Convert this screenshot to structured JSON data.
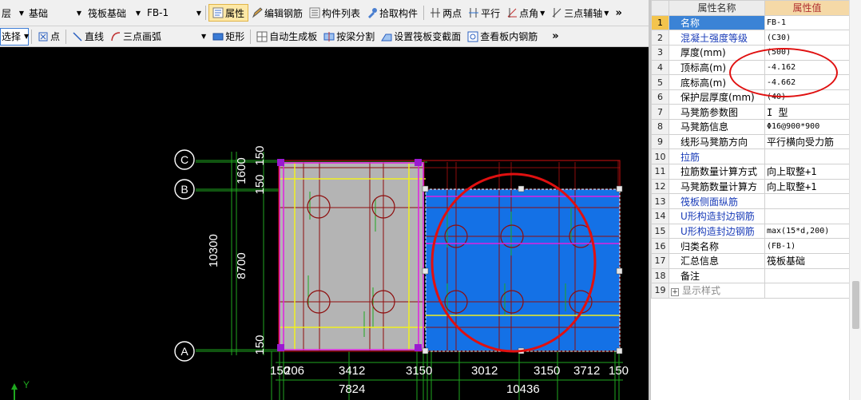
{
  "toolbar1": {
    "floor_combo": "层",
    "category_combo": "基础",
    "type_combo": "筏板基础",
    "element_combo": "FB-1",
    "properties_label": "属性",
    "edit_rebar_label": "编辑钢筋",
    "component_list_label": "构件列表",
    "pick_component_label": "拾取构件",
    "two_points_label": "两点",
    "parallel_label": "平行",
    "point_angle_label": "点角",
    "three_point_aux_label": "三点辅轴",
    "more_label": "»"
  },
  "toolbar2": {
    "select_label": "选择",
    "point_label": "点",
    "line_label": "直线",
    "arc3_label": "三点画弧",
    "rect_label": "矩形",
    "auto_gen_label": "自动生成板",
    "split_by_beam_label": "按梁分割",
    "set_slope_label": "设置筏板变截面",
    "view_rebar_label": "查看板内钢筋",
    "more_label": "»"
  },
  "drawing": {
    "axis_labels": [
      "C",
      "B",
      "A"
    ],
    "left_dims": [
      "150",
      "1600",
      "150",
      "8700",
      "150"
    ],
    "total_height_dim": "10300",
    "bottom_dims_row1": [
      "150",
      "206",
      "3412",
      "3150",
      "3012",
      "3150",
      "3712",
      "150"
    ],
    "bottom_dims_row2": [
      "7824",
      "10436"
    ],
    "ucs_label": "Y"
  },
  "properties": {
    "header_name": "属性名称",
    "header_value": "属性值",
    "rows": [
      {
        "no": "1",
        "name": "名称",
        "value": "FB-1",
        "blue": false
      },
      {
        "no": "2",
        "name": "混凝土强度等级",
        "value": "(C30)",
        "blue": true
      },
      {
        "no": "3",
        "name": "厚度(mm)",
        "value": "(500)",
        "blue": false
      },
      {
        "no": "4",
        "name": "顶标高(m)",
        "value": "-4.162",
        "blue": false
      },
      {
        "no": "5",
        "name": "底标高(m)",
        "value": "-4.662",
        "blue": false
      },
      {
        "no": "6",
        "name": "保护层厚度(mm)",
        "value": "(40)",
        "blue": false
      },
      {
        "no": "7",
        "name": "马凳筋参数图",
        "value": "I 型",
        "blue": false
      },
      {
        "no": "8",
        "name": "马凳筋信息",
        "value": "Φ16@900*900",
        "blue": false
      },
      {
        "no": "9",
        "name": "线形马凳筋方向",
        "value": "平行横向受力筋",
        "blue": false
      },
      {
        "no": "10",
        "name": "拉筋",
        "value": "",
        "blue": true
      },
      {
        "no": "11",
        "name": "拉筋数量计算方式",
        "value": "向上取整+1",
        "blue": false
      },
      {
        "no": "12",
        "name": "马凳筋数量计算方",
        "value": "向上取整+1",
        "blue": false
      },
      {
        "no": "13",
        "name": "筏板侧面纵筋",
        "value": "",
        "blue": true
      },
      {
        "no": "14",
        "name": "U形构造封边钢筋",
        "value": "",
        "blue": true
      },
      {
        "no": "15",
        "name": "U形构造封边钢筋",
        "value": "max(15*d,200)",
        "blue": true
      },
      {
        "no": "16",
        "name": "归类名称",
        "value": "(FB-1)",
        "blue": false
      },
      {
        "no": "17",
        "name": "汇总信息",
        "value": "筏板基础",
        "blue": false
      },
      {
        "no": "18",
        "name": "备注",
        "value": "",
        "blue": false
      },
      {
        "no": "19",
        "name": "显示样式",
        "value": "",
        "blue": false
      }
    ]
  },
  "colors": {
    "slab_grey": "#b4b4b4",
    "slab_blue": "#1471e6",
    "axis_green": "#1fa81f",
    "rebar_dark_red": "#8e0d0d",
    "highlight_red": "#e01010",
    "magenta": "#e020e0",
    "yellow": "#f0f020"
  }
}
